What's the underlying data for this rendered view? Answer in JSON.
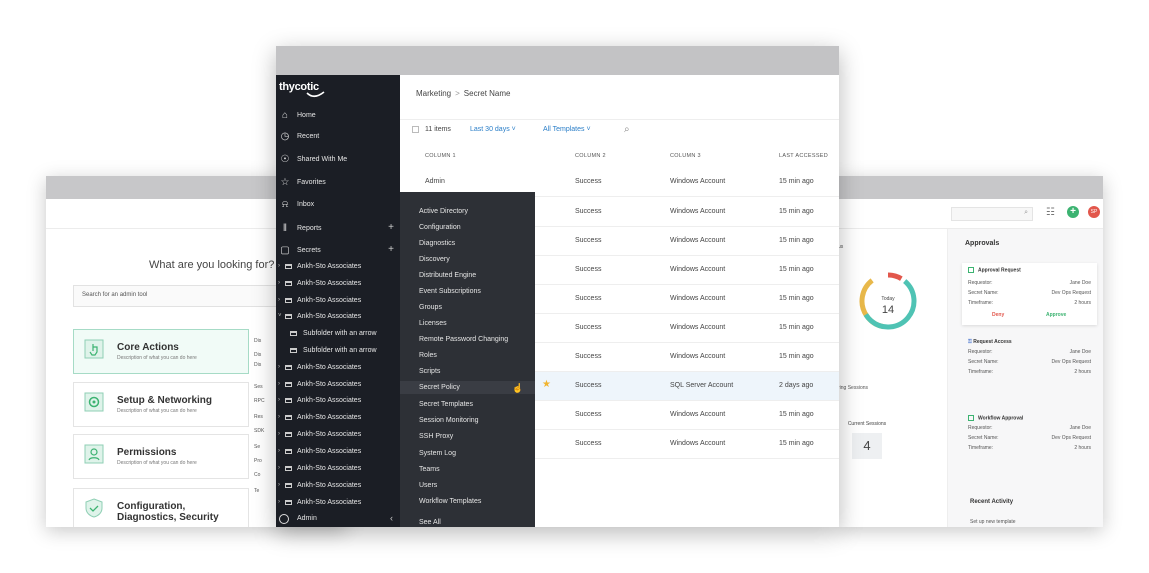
{
  "left_window": {
    "question": "What are you looking for?",
    "search_placeholder": "Search for an admin tool",
    "cards": [
      {
        "title": "Core Actions",
        "desc": "Description of what you can do here"
      },
      {
        "title": "Setup & Networking",
        "desc": "Description of what you can do here"
      },
      {
        "title": "Permissions",
        "desc": "Description of what you can do here"
      },
      {
        "title": "Configuration,",
        "title2": "Diagnostics, Security"
      }
    ],
    "strip": [
      "Dis",
      "Dis",
      "Dis",
      "Ses",
      "RPC",
      "Res",
      "SDK",
      "Se",
      "Pro",
      "Co",
      "Te"
    ]
  },
  "right_window": {
    "status_label": "us",
    "donut_label": "Today",
    "donut_value": "14",
    "sessions_label": "ring Sessions",
    "current_sessions_label": "Current Sessions",
    "current_sessions_value": "4",
    "avatar_initials": "SP",
    "approvals_title": "Approvals",
    "approval_request": {
      "title": "Approval Request",
      "requestor_k": "Requestor:",
      "requestor_v": "Jane Doe",
      "secret_k": "Secret Name:",
      "secret_v": "Dev Ops Request",
      "time_k": "Timeframe:",
      "time_v": "2 hours",
      "deny": "Deny",
      "approve": "Approve"
    },
    "request_access": {
      "title": "Request Access",
      "requestor_k": "Requestor:",
      "requestor_v": "Jane Doe",
      "secret_k": "Secret Name:",
      "secret_v": "Dev Ops Request",
      "time_k": "Timeframe:",
      "time_v": "2 hours"
    },
    "workflow_approval": {
      "title": "Workflow Approval",
      "requestor_k": "Requestor:",
      "requestor_v": "Jane Doe",
      "secret_k": "Secret Name:",
      "secret_v": "Dev Ops Request",
      "time_k": "Timeframe:",
      "time_v": "2 hours"
    },
    "recent_activity_title": "Recent Activity",
    "recent_activity_item": "Set up new template"
  },
  "main_window": {
    "logo": "thycotic",
    "nav": [
      {
        "label": "Home",
        "icon": "home-icon"
      },
      {
        "label": "Recent",
        "icon": "clock-icon"
      },
      {
        "label": "Shared With Me",
        "icon": "share-icon"
      },
      {
        "label": "Favorites",
        "icon": "star-icon"
      },
      {
        "label": "Inbox",
        "icon": "bell-icon"
      },
      {
        "label": "Reports",
        "icon": "reports-icon"
      },
      {
        "label": "Secrets",
        "icon": "lock-icon"
      }
    ],
    "folders": [
      "Ankh-Sto Associates",
      "Ankh-Sto Associates",
      "Ankh-Sto Associates",
      "Ankh-Sto Associates",
      "Subfolder with an arrow",
      "Subfolder with an arrow",
      "Ankh-Sto Associates",
      "Ankh-Sto Associates",
      "Ankh-Sto Associates",
      "Ankh-Sto Associates",
      "Ankh-Sto Associates",
      "Ankh-Sto Associates",
      "Ankh-Sto Associates",
      "Ankh-Sto Associates",
      "Ankh-Sto Associates"
    ],
    "admin_label": "Admin",
    "breadcrumb": {
      "parent": "Marketing",
      "sep": ">",
      "current": "Secret Name"
    },
    "toolbar": {
      "count": "11 items",
      "date_filter": "Last 30 days",
      "template_filter": "All Templates"
    },
    "columns": [
      "COLUMN 1",
      "COLUMN 2",
      "COLUMN 3",
      "LAST ACCESSED"
    ],
    "rows": [
      {
        "c1": "Admin",
        "c2": "Success",
        "c3": "Windows Account",
        "c4": "15 min ago"
      },
      {
        "c1": "",
        "c2": "Success",
        "c3": "Windows Account",
        "c4": "15 min ago"
      },
      {
        "c1": "",
        "c2": "Success",
        "c3": "Windows Account",
        "c4": "15 min ago"
      },
      {
        "c1": "",
        "c2": "Success",
        "c3": "Windows Account",
        "c4": "15 min ago"
      },
      {
        "c1": "",
        "c2": "Success",
        "c3": "Windows Account",
        "c4": "15 min ago"
      },
      {
        "c1": "",
        "c2": "Success",
        "c3": "Windows Account",
        "c4": "15 min ago"
      },
      {
        "c1": "",
        "c2": "Success",
        "c3": "Windows Account",
        "c4": "15 min ago"
      },
      {
        "c1": "",
        "c2": "Success",
        "c3": "SQL Server Account",
        "c4": "2 days ago"
      },
      {
        "c1": "",
        "c2": "Success",
        "c3": "Windows Account",
        "c4": "15 min ago"
      },
      {
        "c1": "",
        "c2": "Success",
        "c3": "Windows Account",
        "c4": "15 min ago"
      }
    ],
    "admin_menu": [
      "Active Directory",
      "Configuration",
      "Diagnostics",
      "Discovery",
      "Distributed Engine",
      "Event Subscriptions",
      "Groups",
      "Licenses",
      "Remote Password Changing",
      "Roles",
      "Scripts",
      "Secret Policy",
      "Secret Templates",
      "Session Monitoring",
      "SSH Proxy",
      "System Log",
      "Teams",
      "Users",
      "Workflow Templates",
      "See All"
    ]
  },
  "colors": {
    "accent_blue": "#2a7ec8",
    "sidebar": "#1b1e25",
    "menu": "#2d3036",
    "green": "#3cb371",
    "red": "#e2574c",
    "star": "#f1b42f"
  }
}
